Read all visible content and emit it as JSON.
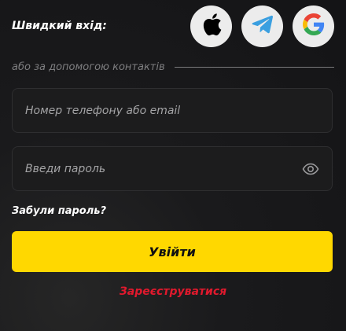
{
  "quick_login": {
    "label": "Швидкий вхід:",
    "providers": [
      {
        "name": "apple",
        "icon": "apple-icon"
      },
      {
        "name": "telegram",
        "icon": "telegram-icon"
      },
      {
        "name": "google",
        "icon": "google-icon"
      }
    ]
  },
  "divider": {
    "text": "або за допомогою контактів"
  },
  "form": {
    "phone_placeholder": "Номер телефону або email",
    "phone_value": "",
    "password_placeholder": "Введи пароль",
    "password_value": "",
    "toggle_icon": "eye-icon",
    "forgot_label": "Забули пароль?",
    "submit_label": "Увійти",
    "register_label": "Зареєструватися"
  },
  "colors": {
    "background": "#1a1a1c",
    "accent": "#ffd800",
    "register": "#e0192d",
    "social_bg": "#ececec",
    "telegram": "#3a9fe0"
  }
}
